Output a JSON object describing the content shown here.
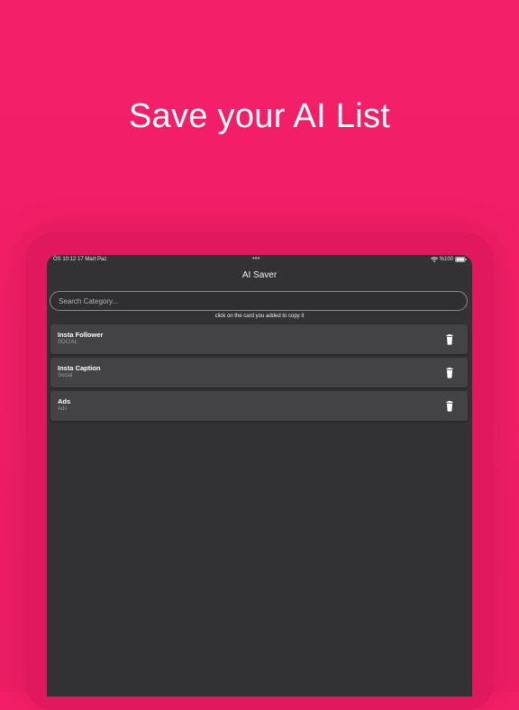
{
  "headline": "Save your AI List",
  "status_bar": {
    "time": "ÖS 10:12  17 Mart Paz",
    "dots": "•••",
    "battery": "%100"
  },
  "app": {
    "title": "AI Saver",
    "search": {
      "placeholder": "Search Category...",
      "value": ""
    },
    "hint": "click on the card you added to copy it",
    "cards": [
      {
        "title": "Insta Follower",
        "category": "SOCIAL"
      },
      {
        "title": "Insta Caption",
        "category": "Social"
      },
      {
        "title": "Ads",
        "category": "Ads"
      }
    ]
  },
  "colors": {
    "background": "#f41f68",
    "screen": "#323234",
    "card": "#434345"
  },
  "icons": {
    "wifi": "wifi-icon",
    "battery": "battery-icon",
    "delete": "trash-icon"
  }
}
